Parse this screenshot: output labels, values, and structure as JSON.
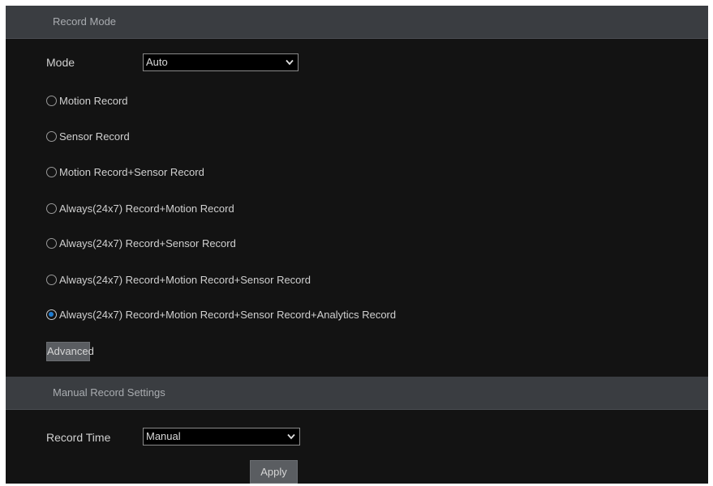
{
  "record_mode_section": {
    "title": "Record Mode",
    "mode_label": "Mode",
    "mode_value": "Auto",
    "options": [
      {
        "label": "Motion Record",
        "selected": false
      },
      {
        "label": "Sensor Record",
        "selected": false
      },
      {
        "label": "Motion Record+Sensor Record",
        "selected": false
      },
      {
        "label": "Always(24x7) Record+Motion Record",
        "selected": false
      },
      {
        "label": "Always(24x7) Record+Sensor Record",
        "selected": false
      },
      {
        "label": "Always(24x7) Record+Motion Record+Sensor Record",
        "selected": false
      },
      {
        "label": "Always(24x7) Record+Motion Record+Sensor Record+Analytics Record",
        "selected": true
      }
    ],
    "advanced_label": "Advanced"
  },
  "manual_section": {
    "title": "Manual Record Settings",
    "record_time_label": "Record Time",
    "record_time_value": "Manual"
  },
  "apply_label": "Apply",
  "colors": {
    "panel_bg": "#131313",
    "header_bg": "#3a3d41",
    "radio_selected": "#1e7bd1",
    "button_bg": "#5a5d61"
  }
}
